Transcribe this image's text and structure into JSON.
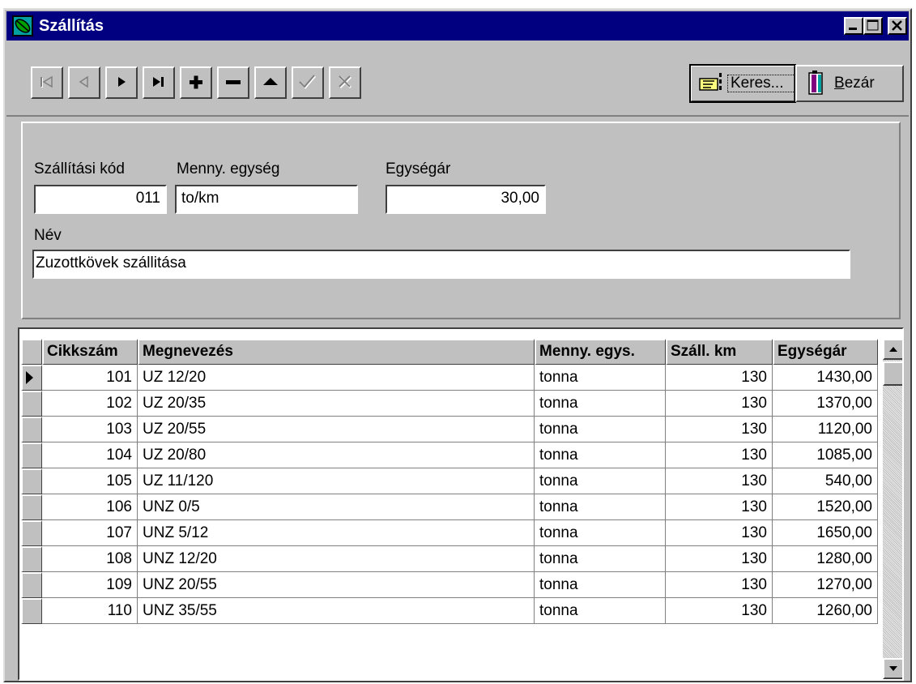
{
  "window": {
    "title": "Szállítás"
  },
  "toolbar": {
    "search_label": "Keres...",
    "close_label_accel": "B",
    "close_label_rest": "ezár"
  },
  "form": {
    "code_label": "Szállítási kód",
    "code_value": "011",
    "unit_label": "Menny. egység",
    "unit_value": "to/km",
    "price_label": "Egységár",
    "price_value": "30,00",
    "name_label": "Név",
    "name_value": "Zuzottkövek szállitása"
  },
  "grid": {
    "columns": [
      "Cikkszám",
      "Megnevezés",
      "Menny. egys.",
      "Száll. km",
      "Egységár"
    ],
    "rows": [
      [
        "101",
        "UZ 12/20",
        "tonna",
        "130",
        "1430,00"
      ],
      [
        "102",
        "UZ 20/35",
        "tonna",
        "130",
        "1370,00"
      ],
      [
        "103",
        "UZ 20/55",
        "tonna",
        "130",
        "1120,00"
      ],
      [
        "104",
        "UZ 20/80",
        "tonna",
        "130",
        "1085,00"
      ],
      [
        "105",
        "UZ 11/120",
        "tonna",
        "130",
        "540,00"
      ],
      [
        "106",
        "UNZ 0/5",
        "tonna",
        "130",
        "1520,00"
      ],
      [
        "107",
        "UNZ 5/12",
        "tonna",
        "130",
        "1650,00"
      ],
      [
        "108",
        "UNZ 12/20",
        "tonna",
        "130",
        "1280,00"
      ],
      [
        "109",
        "UNZ 20/55",
        "tonna",
        "130",
        "1270,00"
      ],
      [
        "110",
        "UNZ 35/55",
        "tonna",
        "130",
        "1260,00"
      ]
    ]
  },
  "icons": {
    "first": "first-record-icon",
    "prior": "prior-record-icon",
    "next": "next-record-icon",
    "last": "last-record-icon",
    "insert": "insert-icon",
    "delete": "delete-icon",
    "edit": "edit-icon",
    "post": "post-icon",
    "cancel": "cancel-icon",
    "search": "search-hand-icon",
    "close": "door-icon",
    "current_row": "current-row-arrow-icon"
  },
  "colors": {
    "title_bar": "#000080",
    "face": "#c0c0c0",
    "field_bg": "#ffffff"
  }
}
